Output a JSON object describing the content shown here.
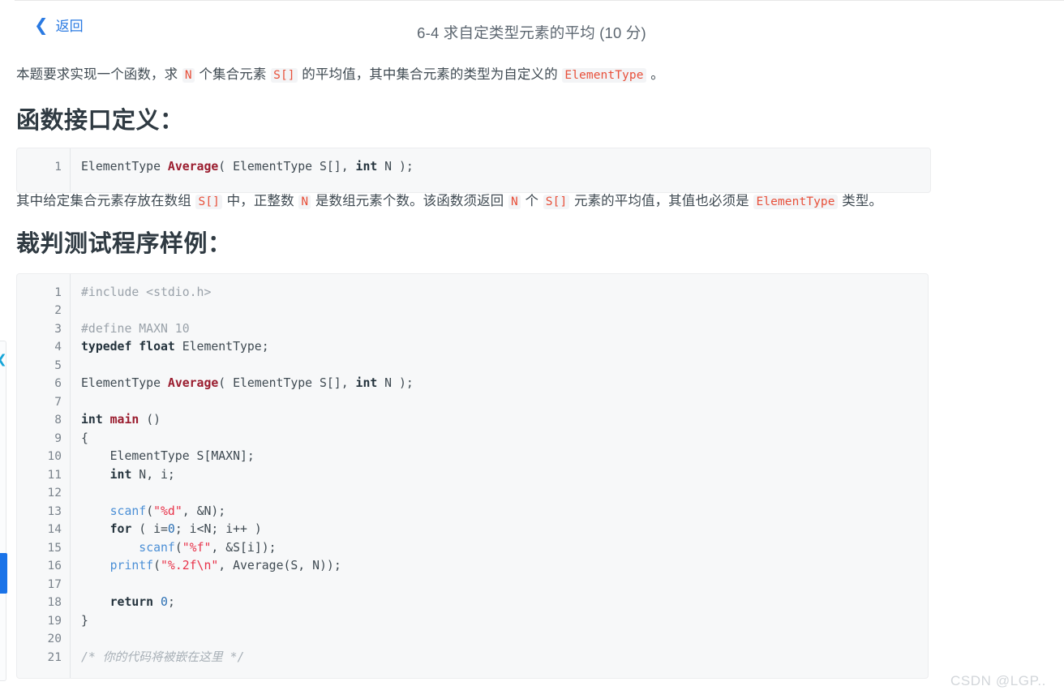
{
  "header": {
    "back_icon": "chevron-left-icon",
    "back_label": "返回",
    "title": "6-4 求自定类型元素的平均 (10 分)"
  },
  "rail": {
    "collapse_icon": "chevron-left-icon",
    "scroll_indicator_color": "#1a73e8",
    "chevron_color": "#16a5d8"
  },
  "body": {
    "intro": {
      "seg1": "本题要求实现一个函数，求 ",
      "code1": "N",
      "seg2": " 个集合元素 ",
      "code2": "S[]",
      "seg3": " 的平均值，其中集合元素的类型为自定义的 ",
      "code3": "ElementType",
      "seg4": " 。"
    },
    "section1_title": "函数接口定义：",
    "interface_code": {
      "line_numbers": [
        "1"
      ],
      "lines": [
        [
          {
            "t": "ElementType ",
            "c": "t-plain"
          },
          {
            "t": "Average",
            "c": "t-fn"
          },
          {
            "t": "( ElementType S[], ",
            "c": "t-plain"
          },
          {
            "t": "int",
            "c": "t-kw"
          },
          {
            "t": " N );",
            "c": "t-plain"
          }
        ]
      ]
    },
    "detail": {
      "seg1": "其中给定集合元素存放在数组 ",
      "code1": "S[]",
      "seg2": " 中，正整数 ",
      "code2": "N",
      "seg3": " 是数组元素个数。该函数须返回 ",
      "code3": "N",
      "seg4": " 个 ",
      "code4": "S[]",
      "seg5": " 元素的平均值，其值也必须是 ",
      "code5": "ElementType",
      "seg6": " 类型。"
    },
    "section2_title": "裁判测试程序样例：",
    "sample_code": {
      "line_numbers": [
        "1",
        "2",
        "3",
        "4",
        "5",
        "6",
        "7",
        "8",
        "9",
        "10",
        "11",
        "12",
        "13",
        "14",
        "15",
        "16",
        "17",
        "18",
        "19",
        "20",
        "21"
      ],
      "lines": [
        [
          {
            "t": "#include <stdio.h>",
            "c": "t-pre"
          }
        ],
        [],
        [
          {
            "t": "#define MAXN 10",
            "c": "t-pre"
          }
        ],
        [
          {
            "t": "typedef float",
            "c": "t-kw"
          },
          {
            "t": " ElementType;",
            "c": "t-plain"
          }
        ],
        [],
        [
          {
            "t": "ElementType ",
            "c": "t-plain"
          },
          {
            "t": "Average",
            "c": "t-fn"
          },
          {
            "t": "( ElementType S[], ",
            "c": "t-plain"
          },
          {
            "t": "int",
            "c": "t-kw"
          },
          {
            "t": " N );",
            "c": "t-plain"
          }
        ],
        [],
        [
          {
            "t": "int ",
            "c": "t-kw"
          },
          {
            "t": "main",
            "c": "t-fn"
          },
          {
            "t": " ()",
            "c": "t-plain"
          }
        ],
        [
          {
            "t": "{",
            "c": "t-plain"
          }
        ],
        [
          {
            "t": "    ElementType S[MAXN];",
            "c": "t-plain"
          }
        ],
        [
          {
            "t": "    ",
            "c": "t-plain"
          },
          {
            "t": "int",
            "c": "t-kw"
          },
          {
            "t": " N, i;",
            "c": "t-plain"
          }
        ],
        [],
        [
          {
            "t": "    ",
            "c": "t-plain"
          },
          {
            "t": "scanf",
            "c": "t-call"
          },
          {
            "t": "(",
            "c": "t-plain"
          },
          {
            "t": "\"%d\"",
            "c": "t-str"
          },
          {
            "t": ", &N);",
            "c": "t-plain"
          }
        ],
        [
          {
            "t": "    ",
            "c": "t-plain"
          },
          {
            "t": "for",
            "c": "t-kw"
          },
          {
            "t": " ( i=",
            "c": "t-plain"
          },
          {
            "t": "0",
            "c": "t-num"
          },
          {
            "t": "; i<N; i++ )",
            "c": "t-plain"
          }
        ],
        [
          {
            "t": "        ",
            "c": "t-plain"
          },
          {
            "t": "scanf",
            "c": "t-call"
          },
          {
            "t": "(",
            "c": "t-plain"
          },
          {
            "t": "\"%f\"",
            "c": "t-str"
          },
          {
            "t": ", &S[i]);",
            "c": "t-plain"
          }
        ],
        [
          {
            "t": "    ",
            "c": "t-plain"
          },
          {
            "t": "printf",
            "c": "t-call"
          },
          {
            "t": "(",
            "c": "t-plain"
          },
          {
            "t": "\"%.2f\\n\"",
            "c": "t-str"
          },
          {
            "t": ", Average(S, N));",
            "c": "t-plain"
          }
        ],
        [],
        [
          {
            "t": "    ",
            "c": "t-plain"
          },
          {
            "t": "return",
            "c": "t-kw"
          },
          {
            "t": " ",
            "c": "t-plain"
          },
          {
            "t": "0",
            "c": "t-num"
          },
          {
            "t": ";",
            "c": "t-plain"
          }
        ],
        [
          {
            "t": "}",
            "c": "t-plain"
          }
        ],
        [],
        [
          {
            "t": "/* 你的代码将被嵌在这里 */",
            "c": "t-cmt"
          }
        ]
      ]
    }
  },
  "watermark": "CSDN @LGP.."
}
